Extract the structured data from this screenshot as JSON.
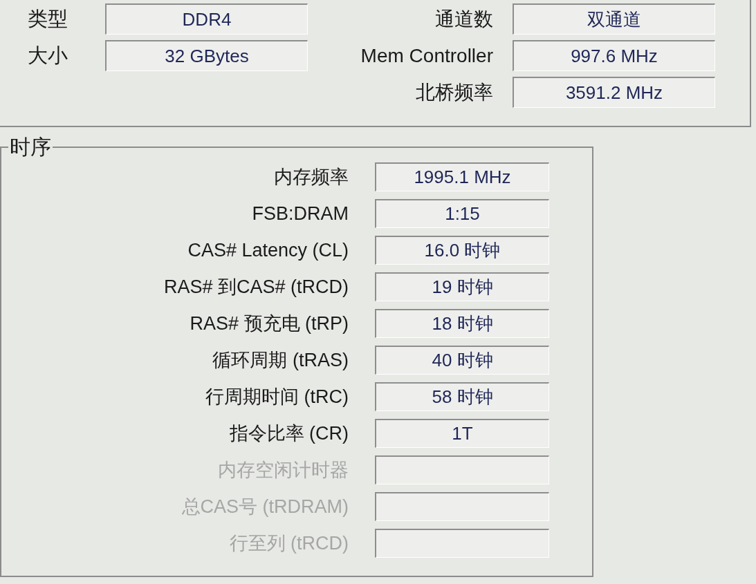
{
  "general": {
    "left": [
      {
        "label": "类型",
        "value": "DDR4"
      },
      {
        "label": "大小",
        "value": "32 GBytes"
      }
    ],
    "right": [
      {
        "label": "通道数",
        "value": "双通道"
      },
      {
        "label": "Mem Controller",
        "value": "997.6 MHz"
      },
      {
        "label": "北桥频率",
        "value": "3591.2 MHz"
      }
    ]
  },
  "timings": {
    "title": "时序",
    "rows": [
      {
        "label": "内存频率",
        "value": "1995.1 MHz",
        "disabled": false
      },
      {
        "label": "FSB:DRAM",
        "value": "1:15",
        "disabled": false
      },
      {
        "label": "CAS# Latency (CL)",
        "value": "16.0 时钟",
        "disabled": false
      },
      {
        "label": "RAS# 到CAS# (tRCD)",
        "value": "19 时钟",
        "disabled": false
      },
      {
        "label": "RAS# 预充电 (tRP)",
        "value": "18 时钟",
        "disabled": false
      },
      {
        "label": "循环周期 (tRAS)",
        "value": "40 时钟",
        "disabled": false
      },
      {
        "label": "行周期时间 (tRC)",
        "value": "58 时钟",
        "disabled": false
      },
      {
        "label": "指令比率 (CR)",
        "value": "1T",
        "disabled": false
      },
      {
        "label": "内存空闲计时器",
        "disabled": true
      },
      {
        "label": "总CAS号 (tRDRAM)",
        "disabled": true
      },
      {
        "label": "行至列 (tRCD)",
        "disabled": true
      }
    ]
  }
}
